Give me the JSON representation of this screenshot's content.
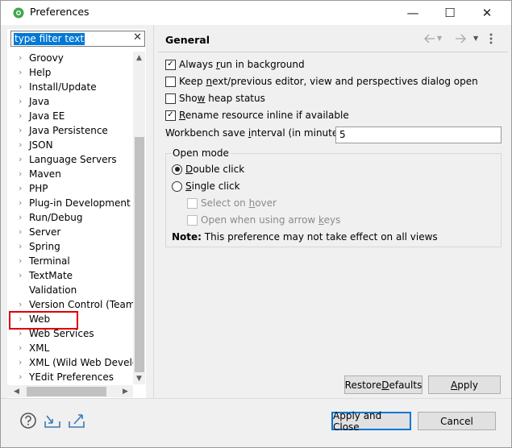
{
  "window": {
    "title": "Preferences",
    "minimize_glyph": "—",
    "maximize_glyph": "☐",
    "close_glyph": "✕"
  },
  "filter": {
    "value": "type filter text",
    "clear_glyph": "✕"
  },
  "tree": {
    "items": [
      {
        "label": "Groovy",
        "expandable": true
      },
      {
        "label": "Help",
        "expandable": true
      },
      {
        "label": "Install/Update",
        "expandable": true
      },
      {
        "label": "Java",
        "expandable": true
      },
      {
        "label": "Java EE",
        "expandable": true
      },
      {
        "label": "Java Persistence",
        "expandable": true
      },
      {
        "label": "JSON",
        "expandable": true
      },
      {
        "label": "Language Servers",
        "expandable": true
      },
      {
        "label": "Maven",
        "expandable": true
      },
      {
        "label": "PHP",
        "expandable": true
      },
      {
        "label": "Plug-in Development",
        "expandable": true
      },
      {
        "label": "Run/Debug",
        "expandable": true
      },
      {
        "label": "Server",
        "expandable": true
      },
      {
        "label": "Spring",
        "expandable": true
      },
      {
        "label": "Terminal",
        "expandable": true
      },
      {
        "label": "TextMate",
        "expandable": true
      },
      {
        "label": "Validation",
        "expandable": false
      },
      {
        "label": "Version Control (Team)",
        "expandable": true
      },
      {
        "label": "Web",
        "expandable": true,
        "highlighted": true
      },
      {
        "label": "Web Services",
        "expandable": true
      },
      {
        "label": "XML",
        "expandable": true
      },
      {
        "label": "XML (Wild Web Develop",
        "expandable": true
      },
      {
        "label": "YEdit Preferences",
        "expandable": true
      }
    ]
  },
  "page": {
    "title": "General",
    "checkboxes": [
      {
        "pre": "Always ",
        "u": "r",
        "post": "un in background",
        "checked": true
      },
      {
        "pre": "Keep ",
        "u": "n",
        "post": "ext/previous editor, view and perspectives dialog open",
        "checked": false
      },
      {
        "pre": "Sho",
        "u": "w",
        "post": " heap status",
        "checked": false
      },
      {
        "pre": "",
        "u": "R",
        "post": "ename resource inline if available",
        "checked": true
      }
    ],
    "save_interval": {
      "pre": "Workbench save ",
      "u": "i",
      "post": "nterval (in minutes):",
      "value": "5"
    },
    "open_mode": {
      "title": "Open mode",
      "double_click": {
        "pre": "",
        "u": "D",
        "post": "ouble click",
        "selected": true
      },
      "single_click": {
        "pre": "",
        "u": "S",
        "post": "ingle click",
        "selected": false
      },
      "select_on_hover": {
        "pre": "Select on ",
        "u": "h",
        "post": "over"
      },
      "open_arrow_keys": {
        "pre": "Open when using arrow ",
        "u": "k",
        "post": "eys"
      },
      "note_bold": "Note:",
      "note_text": " This preference may not take effect on all views"
    },
    "restore_defaults": {
      "pre": "Restore ",
      "u": "D",
      "post": "efaults"
    },
    "apply": {
      "pre": "",
      "u": "A",
      "post": "pply"
    }
  },
  "footer": {
    "apply_and_close": "Apply and Close",
    "cancel": "Cancel"
  },
  "colors": {
    "accent": "#0078d7",
    "highlight_box": "#e00000",
    "dialog_bg": "#f0f0f0"
  },
  "icons": [
    "eclipse-app-icon",
    "help-icon",
    "import-icon",
    "export-icon",
    "back-arrow-icon",
    "forward-arrow-icon",
    "view-menu-icon"
  ]
}
